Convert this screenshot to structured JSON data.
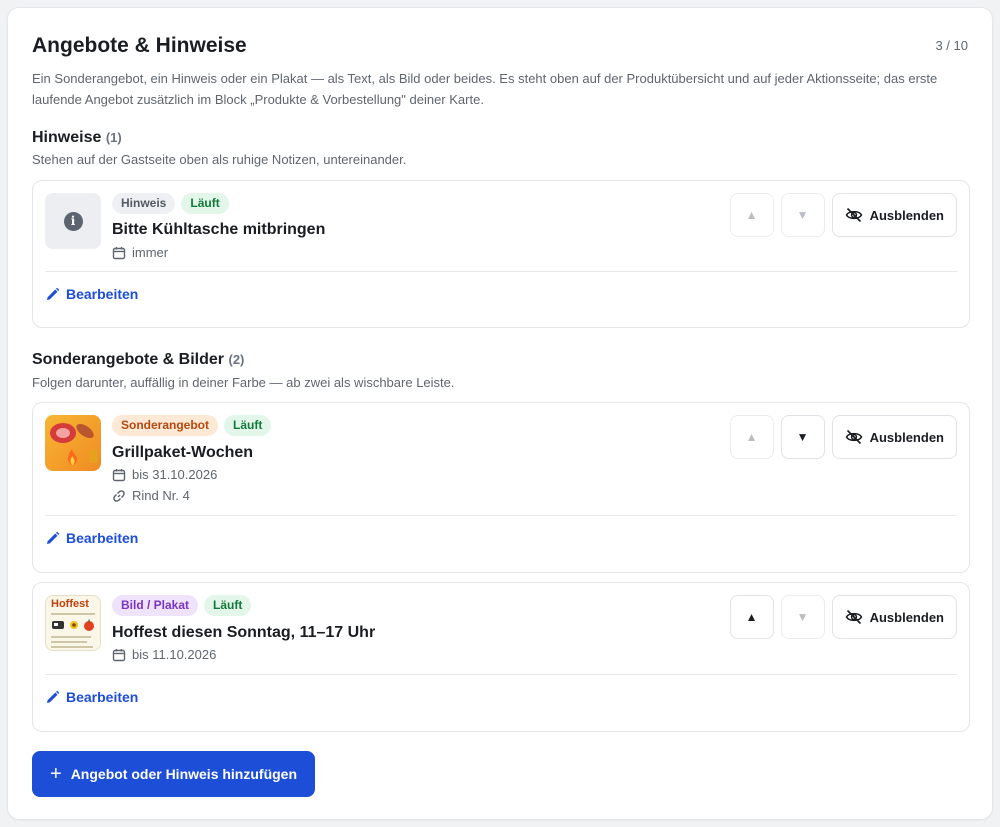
{
  "header": {
    "title": "Angebote & Hinweise",
    "counter": "3 / 10",
    "intro": "Ein Sonderangebot, ein Hinweis oder ein Plakat — als Text, als Bild oder beides. Es steht oben auf der Produktübersicht und auf jeder Aktionsseite; das erste laufende Angebot zusätzlich im Block „Produkte & Vorbestellung\" deiner Karte."
  },
  "sections": {
    "notes": {
      "title": "Hinweise",
      "count": "(1)",
      "subtitle": "Stehen auf der Gastseite oben als ruhige Notizen, untereinander."
    },
    "offers": {
      "title": "Sonderangebote & Bilder",
      "count": "(2)",
      "subtitle": "Folgen darunter, auffällig in deiner Farbe — ab zwei als wischbare Leiste."
    }
  },
  "items": [
    {
      "type_badge": "Hinweis",
      "status_badge": "Läuft",
      "title": "Bitte Kühltasche mitbringen",
      "date": "immer",
      "thumb_icon": "info-icon",
      "move_up_enabled": false,
      "move_down_enabled": false,
      "up_glyph": "▲",
      "down_glyph": "▼",
      "hide_label": "Ausblenden",
      "edit_label": "Bearbeiten"
    },
    {
      "type_badge": "Sonderangebot",
      "status_badge": "Läuft",
      "title": "Grillpaket-Wochen",
      "date": "bis 31.10.2026",
      "link": "Rind Nr. 4",
      "thumb_icon": "grill-image",
      "move_up_enabled": false,
      "move_down_enabled": true,
      "up_glyph": "▲",
      "down_glyph": "▼",
      "hide_label": "Ausblenden",
      "edit_label": "Bearbeiten"
    },
    {
      "type_badge": "Bild / Plakat",
      "status_badge": "Läuft",
      "title": "Hoffest diesen Sonntag, 11–17 Uhr",
      "date": "bis 11.10.2026",
      "thumb_icon": "poster-image",
      "poster_heading": "Hoffest",
      "move_up_enabled": true,
      "move_down_enabled": false,
      "up_glyph": "▲",
      "down_glyph": "▼",
      "hide_label": "Ausblenden",
      "edit_label": "Bearbeiten"
    }
  ],
  "add_button": {
    "plus": "+",
    "label": "Angebot oder Hinweis hinzufügen"
  },
  "colors": {
    "accent": "#1d4ed8",
    "status_green": "#117a3a",
    "offer_orange": "#b5480e",
    "poster_purple": "#7a35c2"
  }
}
